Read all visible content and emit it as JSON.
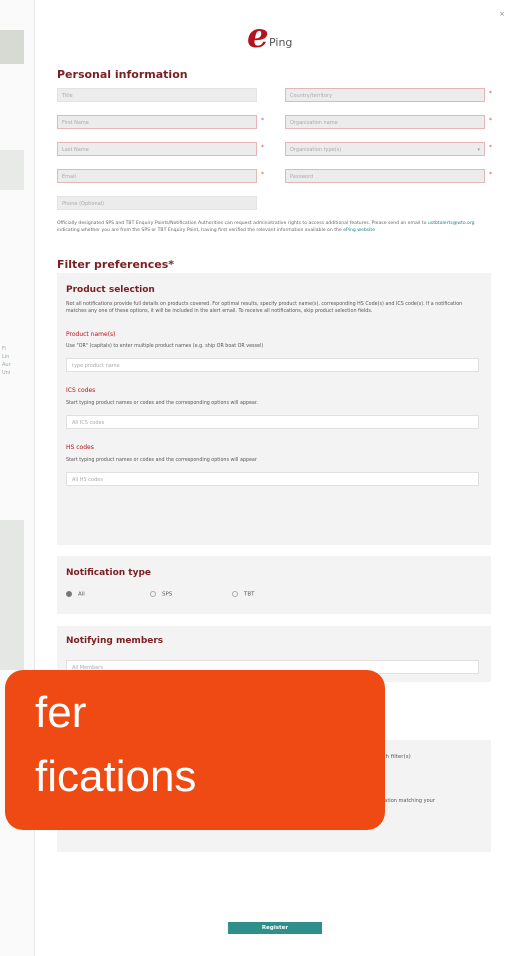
{
  "logo": {
    "mark": "e",
    "name": "Ping"
  },
  "personal": {
    "title": "Personal information",
    "fields_left": [
      {
        "placeholder": "Title",
        "required": false
      },
      {
        "placeholder": "First Name",
        "required": true
      },
      {
        "placeholder": "Last Name",
        "required": true
      },
      {
        "placeholder": "Email",
        "required": true
      },
      {
        "placeholder": "Phone (Optional)",
        "required": false
      }
    ],
    "fields_right": [
      {
        "placeholder": "Country/territory",
        "required": true
      },
      {
        "placeholder": "Organization name",
        "required": true
      },
      {
        "placeholder": "Organization type(s)",
        "required": true
      },
      {
        "placeholder": "Password",
        "required": true
      }
    ],
    "note_main": "Officially designated SPS and TBT Enquiry Points/Notification Authorities can request administrative rights to access additional features. Please send an email to ",
    "note_email": "ustbtalerts@wto.org",
    "note_mid": " indicating whether you are from the SPS or TBT Enquiry Point, having first verified the relevant information available on the ",
    "note_link": "ePing website"
  },
  "filter": {
    "title": "Filter preferences*",
    "product": {
      "title": "Product selection",
      "desc": "Not all notifications provide full details on products covered. For optimal results, specify product name(s), corresponding HS Code(s) and ICS code(s). If a notification matches any one of these options, it will be included in the alert email. To receive all notifications, skip product selection fields.",
      "names_label": "Product name(s)",
      "names_help": "Use \"OR\" (capitals) to enter multiple product names (e.g. ship OR boat OR vessel)",
      "names_placeholder": "type product name",
      "ics_label": "ICS codes",
      "ics_help": "Start typing product names or codes and the corresponding options will appear.",
      "ics_placeholder": "All ICS codes",
      "hs_label": "HS codes",
      "hs_help": "Start typing product names or codes and the corresponding options will appear",
      "hs_placeholder": "All HS codes"
    },
    "notification": {
      "title": "Notification type",
      "options": [
        "All",
        "SPS",
        "TBT"
      ],
      "selected": "All"
    },
    "members": {
      "title": "Notifying members",
      "placeholder": "All Members"
    },
    "search_filter_partial": "arch filter(s)",
    "matching_partial": "ification matching your"
  },
  "register_label": "Register",
  "overlay": {
    "line1": "fer",
    "line2": "fications",
    "color": "#f04a14"
  }
}
